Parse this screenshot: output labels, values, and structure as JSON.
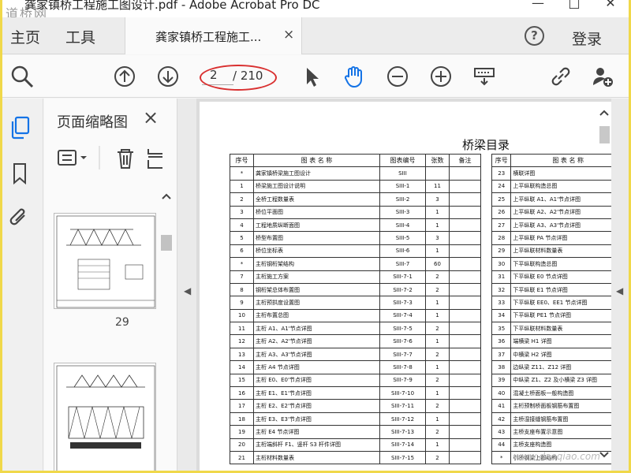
{
  "window": {
    "title": "龚家镇桥工程施工图设计.pdf - Adobe Acrobat Pro DC",
    "watermark_top": "道桥网",
    "minimize": "—",
    "maximize": "□",
    "close": "✕"
  },
  "tabs": {
    "home": "主页",
    "tools": "工具",
    "doc_tab": "龚家镇桥工程施工...",
    "doc_close": "×",
    "help": "?",
    "login": "登录"
  },
  "toolbar": {
    "page_current": "2",
    "page_total": "/ 210",
    "icons": [
      "zoom-search-icon",
      "previous-page-icon",
      "next-page-icon",
      "select-cursor-icon",
      "hand-tool-icon",
      "zoom-out-icon",
      "zoom-in-icon",
      "keyboard-icon",
      "share-link-icon",
      "add-user-icon"
    ],
    "highlight_color": "#d93030"
  },
  "sidebar": {
    "panel_title": "页面缩略图",
    "panel_close": "×",
    "thumbnail_number": "29",
    "rail_icons": [
      "page-thumbnails-icon",
      "bookmark-icon",
      "attachment-icon"
    ],
    "tool_icons": [
      "options-menu-icon",
      "delete-icon",
      "crop-pages-icon"
    ]
  },
  "document": {
    "title": "桥梁目录",
    "headers": [
      "序号",
      "图 表 名 称",
      "图表编号",
      "张数",
      "备注"
    ],
    "headers_right": [
      "序号",
      "图 表 名 称"
    ],
    "rows_left": [
      [
        "*",
        "龚家镇桥梁施工图设计",
        "SIII",
        "",
        ""
      ],
      [
        "1",
        "桥梁施工图设计说明",
        "SIII-1",
        "11",
        ""
      ],
      [
        "2",
        "全桥工程数量表",
        "SIII-2",
        "3",
        ""
      ],
      [
        "3",
        "桥位平面图",
        "SIII-3",
        "1",
        ""
      ],
      [
        "4",
        "工程地质纵断面图",
        "SIII-4",
        "1",
        ""
      ],
      [
        "5",
        "桥型布置图",
        "SIII-5",
        "3",
        ""
      ],
      [
        "6",
        "桥位坐标表",
        "SIII-6",
        "1",
        ""
      ],
      [
        "*",
        "主桁钢桁架结构",
        "SIII-7",
        "60",
        ""
      ],
      [
        "7",
        "主桁施工方案",
        "SIII-7-1",
        "2",
        ""
      ],
      [
        "8",
        "钢桁架总体布置图",
        "SIII-7-2",
        "2",
        ""
      ],
      [
        "9",
        "主桁预拱度设置图",
        "SIII-7-3",
        "1",
        ""
      ],
      [
        "10",
        "主桁布置总图",
        "SIII-7-4",
        "1",
        ""
      ],
      [
        "11",
        "主桁 A1、A1'节点详图",
        "SIII-7-5",
        "2",
        ""
      ],
      [
        "12",
        "主桁 A2、A2'节点详图",
        "SIII-7-6",
        "1",
        ""
      ],
      [
        "13",
        "主桁 A3、A3'节点详图",
        "SIII-7-7",
        "2",
        ""
      ],
      [
        "14",
        "主桁 A4 节点详图",
        "SIII-7-8",
        "1",
        ""
      ],
      [
        "15",
        "主桁 E0、E0'节点详图",
        "SIII-7-9",
        "2",
        ""
      ],
      [
        "16",
        "主桁 E1、E1'节点详图",
        "SIII-7-10",
        "1",
        ""
      ],
      [
        "17",
        "主桁 E2、E2'节点详图",
        "SIII-7-11",
        "2",
        ""
      ],
      [
        "18",
        "主桁 E3、E3'节点详图",
        "SIII-7-12",
        "1",
        ""
      ],
      [
        "19",
        "主桁 E4 节点详图",
        "SIII-7-13",
        "2",
        ""
      ],
      [
        "20",
        "主桁端斜杆 F1、竖杆 S3 杆件详图",
        "SIII-7-14",
        "1",
        ""
      ],
      [
        "21",
        "主桁材料数量表",
        "SIII-7-15",
        "2",
        ""
      ]
    ],
    "rows_right": [
      [
        "23",
        "横联详图"
      ],
      [
        "24",
        "上平纵联构造总图"
      ],
      [
        "25",
        "上平纵联 A1、A1'节点详图"
      ],
      [
        "26",
        "上平纵联 A2、A2'节点详图"
      ],
      [
        "27",
        "上平纵联 A3、A3'节点详图"
      ],
      [
        "28",
        "上平纵联 PA 节点详图"
      ],
      [
        "29",
        "上平纵联材料数量表"
      ],
      [
        "30",
        "下平纵联构造总图"
      ],
      [
        "31",
        "下平纵联 E0 节点详图"
      ],
      [
        "32",
        "下平纵联 E1 节点详图"
      ],
      [
        "33",
        "下平纵联 EE0、EE1 节点详图"
      ],
      [
        "34",
        "下平纵联 PE1 节点详图"
      ],
      [
        "35",
        "下平纵联材料数量表"
      ],
      [
        "36",
        "端横梁 H1 详图"
      ],
      [
        "37",
        "中横梁 H2 详图"
      ],
      [
        "38",
        "边纵梁 Z11、Z12 详图"
      ],
      [
        "39",
        "中纵梁 Z1、Z2 及小横梁 Z3 详图"
      ],
      [
        "40",
        "混凝土桥面板一般构造图"
      ],
      [
        "41",
        "主桁预制桥面板钢筋布置图"
      ],
      [
        "42",
        "主桥湿接缝钢筋布置图"
      ],
      [
        "43",
        "主桥支座布置示意图"
      ],
      [
        "44",
        "主桥支座构造图"
      ],
      [
        "*",
        "引桥钢梁上部结构"
      ]
    ]
  },
  "footer_watermark": "www.daoqiao.com"
}
